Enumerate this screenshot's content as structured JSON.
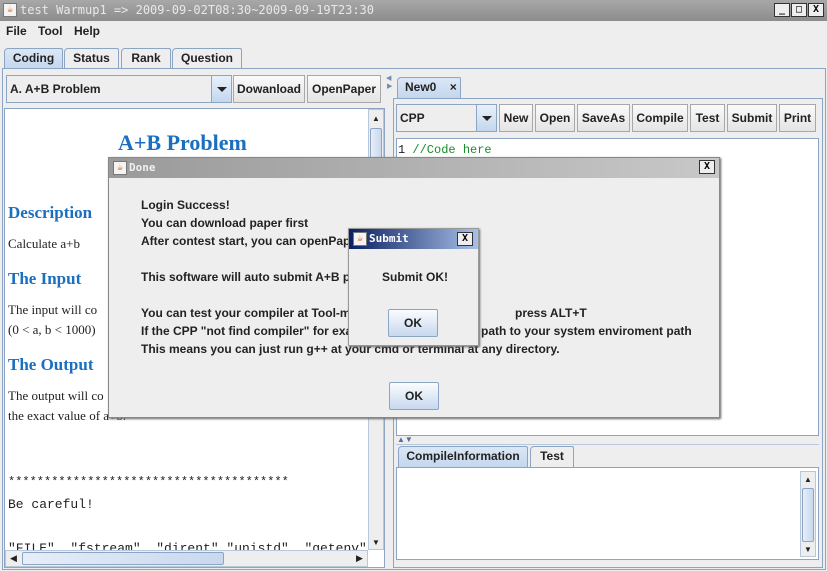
{
  "window": {
    "title": "test Warmup1 => 2009-09-02T08:30~2009-09-19T23:30",
    "minimize": "_",
    "maximize": "□",
    "close": "X"
  },
  "menu": [
    "File",
    "Tool",
    "Help"
  ],
  "main_tabs": [
    "Coding",
    "Status",
    "Rank",
    "Question"
  ],
  "left": {
    "problem_select": "A.  A+B Problem",
    "download_button": "Dowanload",
    "openpaper_button": "OpenPaper",
    "content": {
      "title": "A+B Problem",
      "description_heading": "Description",
      "description": "Calculate a+b",
      "input_heading": "The Input",
      "input_line1": "The input will co",
      "input_line2": "(0 < a, b < 1000)",
      "output_heading": "The Output",
      "output_line1": "The output will co",
      "output_line2": "the exact value of a+b.",
      "stars": "***************************************",
      "careful": "Be careful!",
      "code_line": "\"FILE\"  \"fstream\"  \"dirent\" \"unistd\"  \"getenv\"  \"sys"
    }
  },
  "right": {
    "editor_tab": "New0",
    "editor_tab_close": "×",
    "language_select": "CPP",
    "toolbar": [
      "New",
      "Open",
      "SaveAs",
      "Compile",
      "Test",
      "Submit",
      "Print"
    ],
    "line_number": "1",
    "code": "//Code here",
    "bottom_tabs": [
      "CompileInformation",
      "Test"
    ]
  },
  "done_dialog": {
    "title": "Done",
    "close": "X",
    "lines": [
      {
        "left": "Login Success!",
        "right": ""
      },
      {
        "left": "You can download paper first",
        "right": ""
      },
      {
        "left": "After contest start, you can openPap",
        "right": ""
      },
      {
        "left": "",
        "right": ""
      },
      {
        "left": "This software will auto submit A+B pr",
        "right": ""
      },
      {
        "left": "",
        "right": ""
      },
      {
        "left": "You can test your compiler at Tool-m",
        "right": "press ALT+T"
      },
      {
        "left": "If the CPP \"not find compiler\" for exa",
        "right": "path to your system enviroment path"
      },
      {
        "left": "This means you can just run g++ at your cmd or terminal at any directory.",
        "right": ""
      }
    ],
    "ok": "OK"
  },
  "submit_dialog": {
    "title": "Submit",
    "close": "X",
    "message": "Submit OK!",
    "ok": "OK"
  }
}
